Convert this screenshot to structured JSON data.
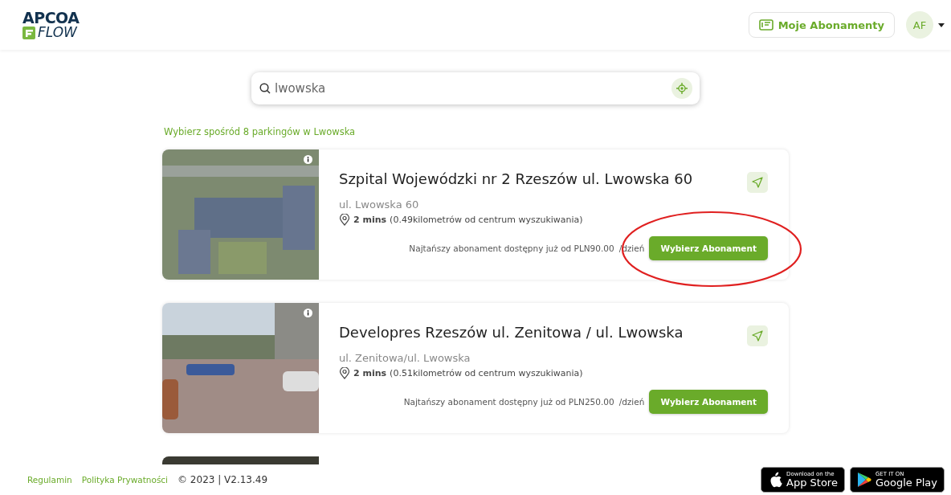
{
  "header": {
    "logo_top": "APCOA",
    "logo_bottom": "FLOW",
    "subscriptions_button": "Moje Abonamenty",
    "avatar_initials": "AF"
  },
  "search": {
    "value": "lwowska"
  },
  "results_heading": "Wybierz spośród 8 parkingów w Lwowska",
  "listings": [
    {
      "kind": "aerial",
      "title": "Szpital Wojewódzki nr 2 Rzeszów ul. Lwowska 60",
      "address": "ul. Lwowska 60",
      "time": "2 mins",
      "distance": "(0.49kilometrów od centrum wyszukiwania)",
      "price_text": "Najtańszy abonament dostępny już od PLN90.00",
      "per": "/dzień",
      "button": "Wybierz Abonament",
      "circled": true
    },
    {
      "kind": "street",
      "title": "Developres Rzeszów ul. Zenitowa / ul. Lwowska",
      "address": "ul. Zenitowa/ul. Lwowska",
      "time": "2 mins",
      "distance": "(0.51kilometrów od centrum wyszukiwania)",
      "price_text": "Najtańszy abonament dostępny już od PLN250.00",
      "per": "/dzień",
      "button": "Wybierz Abonament",
      "circled": false
    },
    {
      "kind": "peek"
    }
  ],
  "footer": {
    "links": [
      "Regulamin",
      "Polityka Prywatności"
    ],
    "copyright": "© 2023 | V2.13.49",
    "app_store": {
      "small": "Download on the",
      "big": "App Store"
    },
    "google_play": {
      "small": "GET IT ON",
      "big": "Google Play"
    }
  }
}
